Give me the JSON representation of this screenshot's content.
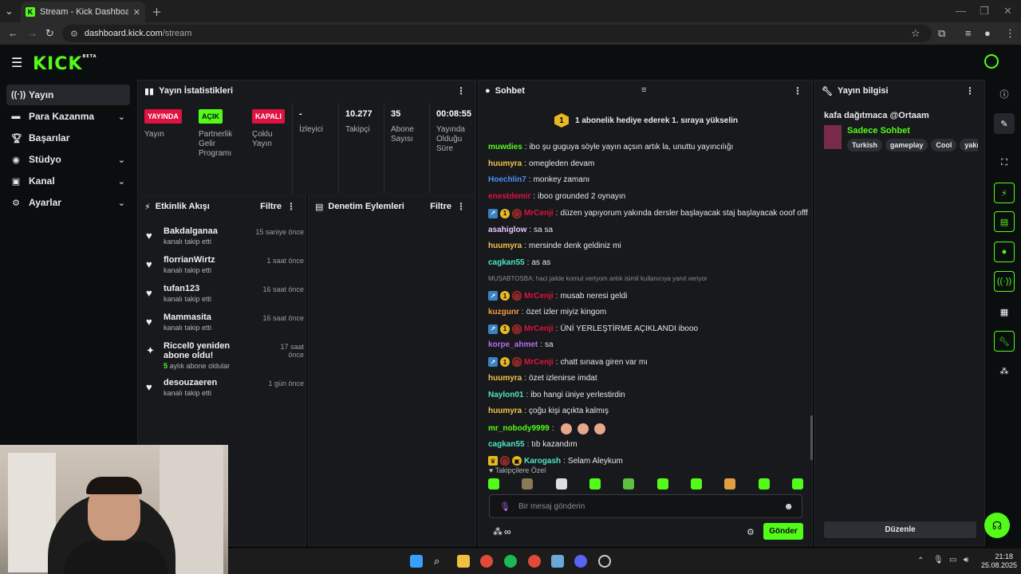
{
  "browser": {
    "tab_title": "Stream - Kick Dashboard",
    "url_host": "dashboard.kick.com",
    "url_path": "/stream"
  },
  "kick": {
    "logo": "KICK",
    "logo_sup": "BETA"
  },
  "sidebar": {
    "items": [
      {
        "label": "Yayın",
        "icon": "broadcast-icon"
      },
      {
        "label": "Para Kazanma",
        "icon": "money-icon"
      },
      {
        "label": "Başarılar",
        "icon": "trophy-icon"
      },
      {
        "label": "Stüdyo",
        "icon": "studio-icon"
      },
      {
        "label": "Kanal",
        "icon": "channel-icon"
      },
      {
        "label": "Ayarlar",
        "icon": "gear-icon"
      }
    ]
  },
  "stats": {
    "title": "Yayın İstatistikleri",
    "cols": [
      {
        "badge": "YAYINDA",
        "label": "Yayın"
      },
      {
        "badge": "AÇIK",
        "label": "Partnerlik Gelir Programı"
      },
      {
        "badge": "KAPALI",
        "label": "Çoklu Yayın"
      },
      {
        "value": "-",
        "label": "İzleyici"
      },
      {
        "value": "10.277",
        "label": "Takipçi"
      },
      {
        "value": "35",
        "label": "Abone Sayısı"
      },
      {
        "value": "00:08:55",
        "label": "Yayında Olduğu Süre"
      }
    ]
  },
  "activity": {
    "title": "Etkinlik Akışı",
    "filter": "Filtre",
    "items": [
      {
        "name": "Bakdalganaa",
        "sub": "kanalı takip etti",
        "time": "15 saniye önce"
      },
      {
        "name": "florrianWirtz",
        "sub": "kanalı takip etti",
        "time": "1 saat önce"
      },
      {
        "name": "tufan123",
        "sub": "kanalı takip etti",
        "time": "16 saat önce"
      },
      {
        "name": "Mammasita",
        "sub": "kanalı takip etti",
        "time": "16 saat önce"
      },
      {
        "name": "Riccel0 yeniden abone oldu!",
        "sub_count": "5",
        "sub": "aylık abone oldular",
        "time": "17 saat önce"
      },
      {
        "name": "desouzaeren",
        "sub": "kanalı takip etti",
        "time": "1 gün önce"
      }
    ]
  },
  "moderation": {
    "title": "Denetim Eylemleri",
    "filter": "Filtre"
  },
  "chat": {
    "title": "Sohbet",
    "pin_count": "1",
    "pin_text": "1 abonelik hediye ederek 1. sıraya yükselin",
    "messages": [
      {
        "user": "muwdies",
        "color": "#53fc18",
        "text": "ibo şu guguya söyle yayın açsın artık la, unuttu yayıncılığı"
      },
      {
        "user": "huumyra",
        "color": "#f3c34a",
        "text": "omegleden devam"
      },
      {
        "user": "Hoechlin7",
        "color": "#4f8ff7",
        "text": "monkey zamanı"
      },
      {
        "user": "enestdemir",
        "color": "#e0123f",
        "text": "iboo grounded 2 oynayın"
      },
      {
        "user": "MrCenji",
        "color": "#e0123f",
        "badges": true,
        "text": "düzen yapıyorum yakında dersler başlayacak staj başlayacak ooof offf"
      },
      {
        "user": "asahiglow",
        "color": "#e7c7ff",
        "text": "sa sa"
      },
      {
        "user": "huumyra",
        "color": "#f3c34a",
        "text": "mersinde denk geldiniz mi"
      },
      {
        "user": "cagkan55",
        "color": "#4ee6c6",
        "text": "as as"
      },
      {
        "reply": "MUSABTOSBA: haci jailde komut veriyom anlık isimli kullanıcıya yanıt veriyor"
      },
      {
        "user": "MrCenji",
        "color": "#e0123f",
        "badges": true,
        "text": "musab neresi geldi"
      },
      {
        "user": "kuzgunr",
        "color": "#f39c3a",
        "text": "özet izler miyiz kingom"
      },
      {
        "user": "MrCenji",
        "color": "#e0123f",
        "badges": true,
        "text": "ÜNİ YERLEŞTİRME AÇIKLANDI ibooo"
      },
      {
        "user": "korpe_ahmet",
        "color": "#b36cf0",
        "text": "sa"
      },
      {
        "user": "MrCenji",
        "color": "#e0123f",
        "badges": true,
        "text": "chatt sınava giren var mı"
      },
      {
        "user": "huumyra",
        "color": "#f3c34a",
        "text": "özet izlenirse imdat"
      },
      {
        "user": "Naylon01",
        "color": "#4ee6c6",
        "text": "ibo hangi üniye yerlestirdin"
      },
      {
        "user": "huumyra",
        "color": "#f3c34a",
        "text": "çoğu kişi açıkta kalmış"
      },
      {
        "user": "mr_nobody9999",
        "color": "#53fc18",
        "emotes": 3,
        "text": ""
      },
      {
        "user": "cagkan55",
        "color": "#4ee6c6",
        "text": "tıb kazandım"
      },
      {
        "user": "Karogash",
        "color": "#4ee6c6",
        "crown": true,
        "text": "Selam Aleykum"
      }
    ],
    "followers_only": "Takipçilere Özel",
    "input_placeholder": "Bir mesaj gönderin",
    "send_label": "Gönder",
    "points": "∞"
  },
  "stream_info": {
    "title": "Yayın bilgisi",
    "stream_title": "kafa dağıtmaca @Ortaam",
    "category": "Sadece Sohbet",
    "tags": [
      "Turkish",
      "gameplay",
      "Cool",
      "yakışık"
    ],
    "edit_label": "Düzenle"
  },
  "taskbar": {
    "time": "21:18",
    "date": "25.08.2025"
  },
  "colors": {
    "accent": "#53fc18",
    "live": "#e0123f",
    "panel": "#17191c"
  }
}
